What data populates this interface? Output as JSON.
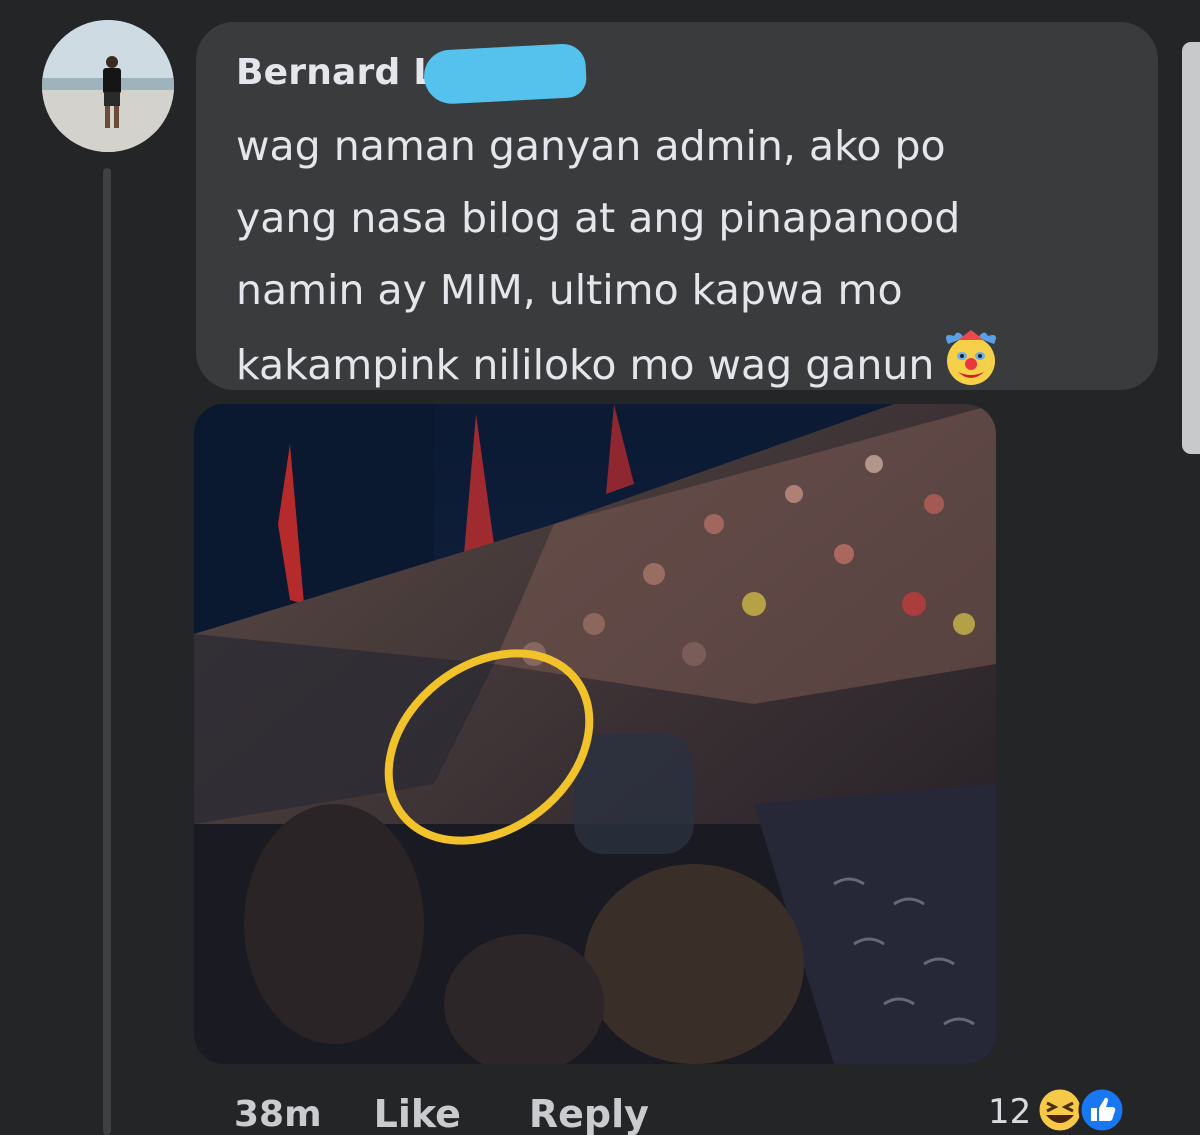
{
  "comment": {
    "author": "Bernard La",
    "text": "wag naman ganyan admin, ako po\nyang nasa bilog at ang pinapanood\nnamin ay MIM, ultimo kapwa mo\nkakampink nililoko mo wag ganun",
    "emoji_icon": "clown-face-icon"
  },
  "actions": {
    "time": "38m",
    "like_label": "Like",
    "reply_label": "Reply"
  },
  "reactions": {
    "count": "12",
    "icons": [
      "haha-icon",
      "like-icon"
    ]
  },
  "colors": {
    "background": "#242526",
    "bubble": "#3a3b3c",
    "text": "#e4e6eb",
    "highlight_circle": "#f2c22b",
    "redaction": "#55c2ee"
  }
}
